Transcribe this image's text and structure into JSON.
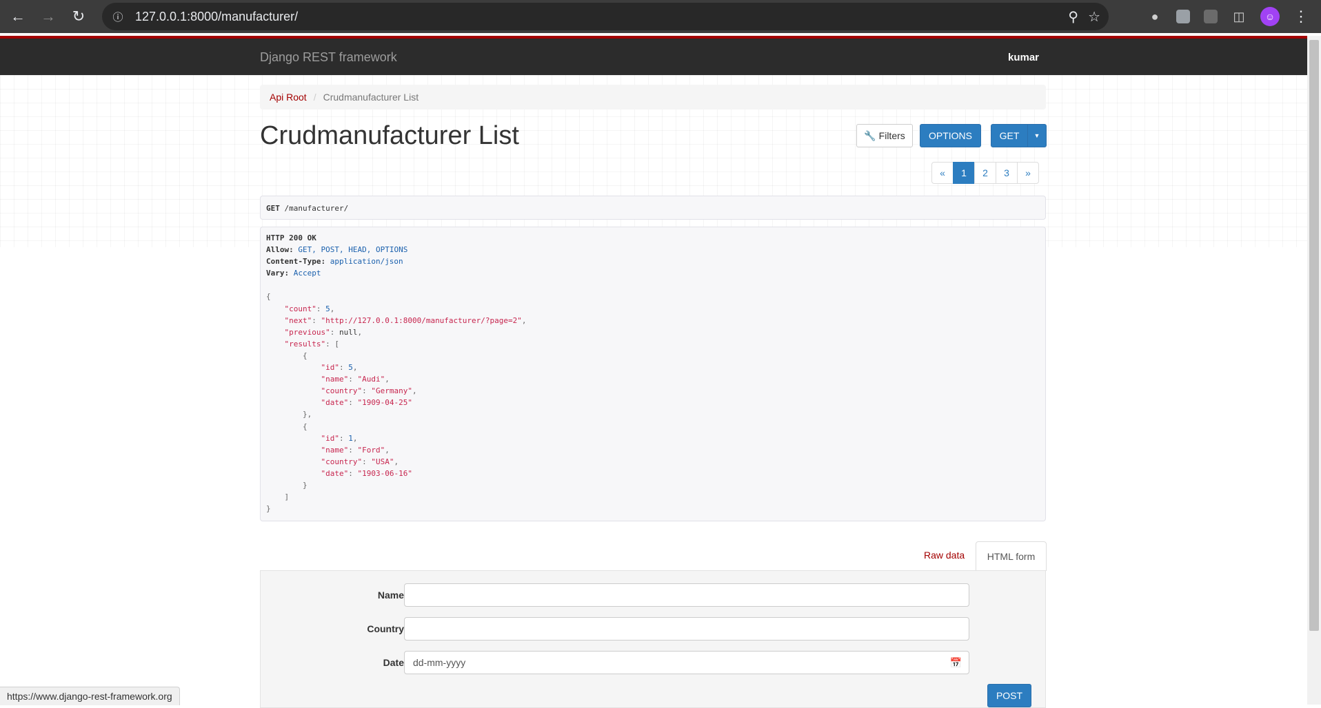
{
  "browser": {
    "url": "127.0.0.1:8000/manufacturer/",
    "icons": [
      "back-icon",
      "forward-icon",
      "reload-icon",
      "info-icon",
      "zoom-icon",
      "star-icon",
      "extensions-icon",
      "profile-avatar",
      "menu-icon"
    ]
  },
  "navbar": {
    "brand": "Django REST framework",
    "user": "kumar"
  },
  "breadcrumb": {
    "root": "Api Root",
    "separator": "/",
    "current": "Crudmanufacturer List"
  },
  "page": {
    "title": "Crudmanufacturer List",
    "filters_label": "Filters",
    "options_label": "OPTIONS",
    "get_label": "GET"
  },
  "pagination": [
    "«",
    "1",
    "2",
    "3",
    "»"
  ],
  "request": {
    "method": "GET",
    "path": "/manufacturer/"
  },
  "response": {
    "status": "HTTP 200 OK",
    "allow_label": "Allow:",
    "allow": "GET, POST, HEAD, OPTIONS",
    "content_type_label": "Content-Type:",
    "content_type": "application/json",
    "vary_label": "Vary:",
    "vary": "Accept",
    "count": "5",
    "next": "\"http://127.0.0.1:8000/manufacturer/?page=2\"",
    "previous": "null",
    "results": [
      {
        "id": "5",
        "name": "\"Audi\"",
        "country": "\"Germany\"",
        "date": "\"1909-04-25\""
      },
      {
        "id": "1",
        "name": "\"Ford\"",
        "country": "\"USA\"",
        "date": "\"1903-06-16\""
      }
    ]
  },
  "tabs": {
    "raw": "Raw data",
    "form": "HTML form"
  },
  "form": {
    "name_label": "Name",
    "country_label": "Country",
    "date_label": "Date",
    "date_placeholder": "dd-mm-yyyy",
    "post_label": "POST"
  },
  "status_bar": "https://www.django-rest-framework.org",
  "colors": {
    "primary": "#2c7dc0",
    "link_red": "#a30000",
    "navbar": "#2c2c2c"
  }
}
